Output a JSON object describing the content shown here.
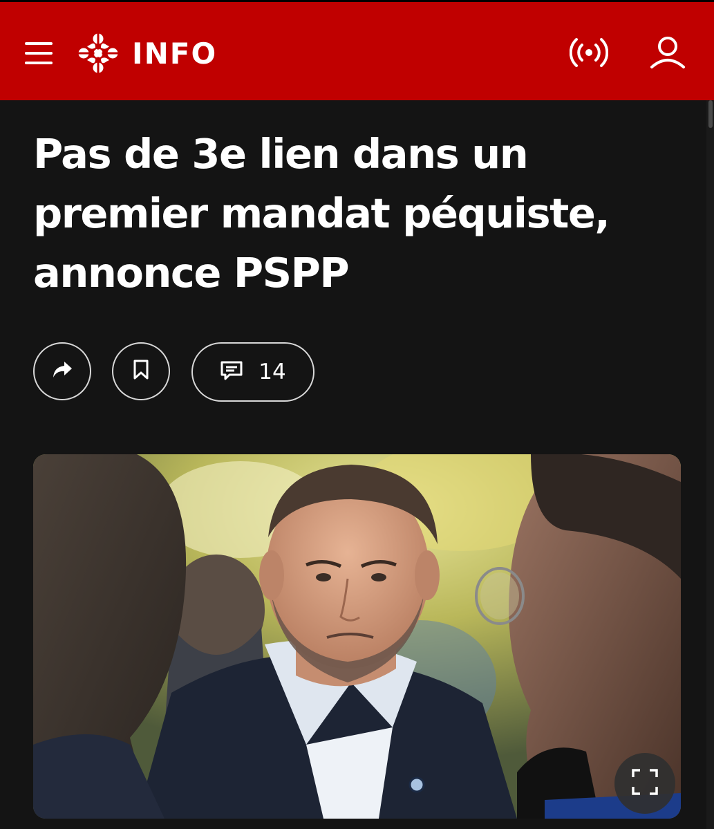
{
  "header": {
    "brand_label": "INFO",
    "menu_icon": "hamburger-menu-icon",
    "logo_icon": "radio-canada-gem-icon",
    "live_icon": "live-broadcast-icon",
    "profile_icon": "user-profile-icon",
    "background_color": "#c00000"
  },
  "article": {
    "headline": "Pas de 3e lien dans un premier mandat péquiste, annonce PSPP",
    "actions": {
      "share_icon": "share-arrow-icon",
      "bookmark_icon": "bookmark-icon",
      "comments_icon": "comment-icon",
      "comments_count": "14"
    },
    "photo": {
      "fullscreen_icon": "fullscreen-expand-icon"
    }
  },
  "colors": {
    "page_background": "#141414",
    "text": "#ffffff",
    "button_outline": "#d8d8d8"
  }
}
